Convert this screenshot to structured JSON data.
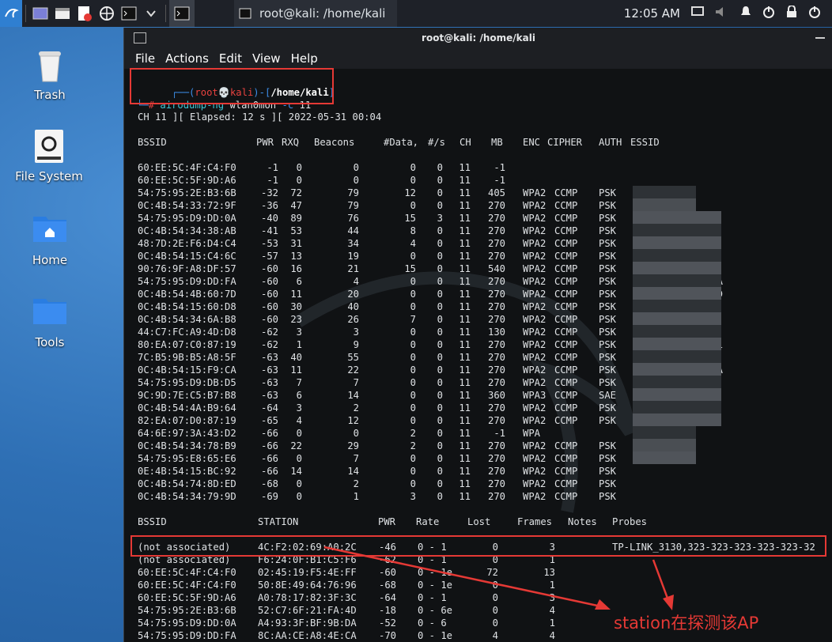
{
  "taskbar": {
    "task_title": "root@kali: /home/kali",
    "clock": "12:05 AM",
    "launchers": [
      "kali-menu-icon",
      "workspace-icon",
      "file-manager-icon",
      "text-editor-icon",
      "browser-icon",
      "terminal-icon",
      "dropdown-icon"
    ]
  },
  "desktop": {
    "icons": [
      {
        "label": "Trash",
        "icon": "trash-icon"
      },
      {
        "label": "File System",
        "icon": "drive-icon"
      },
      {
        "label": "Home",
        "icon": "home-folder-icon"
      },
      {
        "label": "Tools",
        "icon": "folder-icon"
      }
    ]
  },
  "terminal": {
    "title": "root@kali: /home/kali",
    "menu": [
      "File",
      "Actions",
      "Edit",
      "View",
      "Help"
    ],
    "prompt": {
      "user": "root",
      "host": "kali",
      "path": "/home/kali",
      "hash": "#",
      "cmd": "airodump-ng",
      "args": "wlan0mon",
      "flag": "-c",
      "flag_val": "11"
    },
    "status_line": "CH 11 ][ Elapsed: 12 s ][ 2022-05-31 00:04",
    "ap_headers": [
      "BSSID",
      "PWR",
      "RXQ",
      "Beacons",
      "#Data,",
      "#/s",
      "CH",
      "MB",
      "ENC",
      "CIPHER",
      "AUTH",
      "ESSID"
    ],
    "aps": [
      [
        "60:EE:5C:4F:C4:F0",
        "-1",
        "0",
        "0",
        "0",
        "0",
        "11",
        "-1",
        "",
        "",
        "",
        ""
      ],
      [
        "60:EE:5C:5F:9D:A6",
        "-1",
        "0",
        "0",
        "0",
        "0",
        "11",
        "-1",
        "",
        "",
        "",
        ""
      ],
      [
        "54:75:95:2E:B3:6B",
        "-32",
        "72",
        "79",
        "12",
        "0",
        "11",
        "405",
        "WPA2",
        "CCMP",
        "PSK",
        ""
      ],
      [
        "0C:4B:54:33:72:9F",
        "-36",
        "47",
        "79",
        "0",
        "0",
        "11",
        "270",
        "WPA2",
        "CCMP",
        "PSK",
        ""
      ],
      [
        "54:75:95:D9:DD:0A",
        "-40",
        "89",
        "76",
        "15",
        "3",
        "11",
        "270",
        "WPA2",
        "CCMP",
        "PSK",
        ""
      ],
      [
        "0C:4B:54:34:38:AB",
        "-41",
        "53",
        "44",
        "8",
        "0",
        "11",
        "270",
        "WPA2",
        "CCMP",
        "PSK",
        ""
      ],
      [
        "48:7D:2E:F6:D4:C4",
        "-53",
        "31",
        "34",
        "4",
        "0",
        "11",
        "270",
        "WPA2",
        "CCMP",
        "PSK",
        ""
      ],
      [
        "0C:4B:54:15:C4:6C",
        "-57",
        "13",
        "19",
        "0",
        "0",
        "11",
        "270",
        "WPA2",
        "CCMP",
        "PSK",
        ""
      ],
      [
        "90:76:9F:A8:DF:57",
        "-60",
        "16",
        "21",
        "15",
        "0",
        "11",
        "540",
        "WPA2",
        "CCMP",
        "PSK",
        ""
      ],
      [
        "54:75:95:D9:DD:FA",
        "-60",
        "6",
        "4",
        "0",
        "0",
        "11",
        "270",
        "WPA2",
        "CCMP",
        "PSK",
        "A"
      ],
      [
        "0C:4B:54:4B:60:7D",
        "-60",
        "11",
        "20",
        "0",
        "0",
        "11",
        "270",
        "WPA2",
        "CCMP",
        "PSK",
        "D"
      ],
      [
        "0C:4B:54:15:60:D8",
        "-60",
        "30",
        "40",
        "0",
        "0",
        "11",
        "270",
        "WPA2",
        "CCMP",
        "PSK",
        ""
      ],
      [
        "0C:4B:54:34:6A:B8",
        "-60",
        "23",
        "26",
        "7",
        "0",
        "11",
        "270",
        "WPA2",
        "CCMP",
        "PSK",
        ""
      ],
      [
        "44:C7:FC:A9:4D:D8",
        "-62",
        "3",
        "3",
        "0",
        "0",
        "11",
        "130",
        "WPA2",
        "CCMP",
        "PSK",
        ""
      ],
      [
        "80:EA:07:C0:87:19",
        "-62",
        "1",
        "9",
        "0",
        "0",
        "11",
        "270",
        "WPA2",
        "CCMP",
        "PSK",
        "Fi"
      ],
      [
        "7C:B5:9B:B5:A8:5F",
        "-63",
        "40",
        "55",
        "0",
        "0",
        "11",
        "270",
        "WPA2",
        "CCMP",
        "PSK",
        ""
      ],
      [
        "0C:4B:54:15:F9:CA",
        "-63",
        "11",
        "22",
        "0",
        "0",
        "11",
        "270",
        "WPA2",
        "CCMP",
        "PSK",
        "A"
      ],
      [
        "54:75:95:D9:DB:D5",
        "-63",
        "7",
        "7",
        "0",
        "0",
        "11",
        "270",
        "WPA2",
        "CCMP",
        "PSK",
        ""
      ],
      [
        "9C:9D:7E:C5:B7:B8",
        "-63",
        "6",
        "14",
        "0",
        "0",
        "11",
        "360",
        "WPA3",
        "CCMP",
        "SAE",
        ""
      ],
      [
        "0C:4B:54:4A:B9:64",
        "-64",
        "3",
        "2",
        "0",
        "0",
        "11",
        "270",
        "WPA2",
        "CCMP",
        "PSK",
        ""
      ],
      [
        "82:EA:07:D0:87:19",
        "-65",
        "4",
        "12",
        "0",
        "0",
        "11",
        "270",
        "WPA2",
        "CCMP",
        "PSK",
        ""
      ],
      [
        "64:6E:97:3A:43:D2",
        "-66",
        "0",
        "0",
        "2",
        "0",
        "11",
        "-1",
        "WPA",
        "",
        "",
        ""
      ],
      [
        "0C:4B:54:34:78:B9",
        "-66",
        "22",
        "29",
        "2",
        "0",
        "11",
        "270",
        "WPA2",
        "CCMP",
        "PSK",
        ""
      ],
      [
        "54:75:95:E8:65:E6",
        "-66",
        "0",
        "7",
        "0",
        "0",
        "11",
        "270",
        "WPA2",
        "CCMP",
        "PSK",
        ""
      ],
      [
        "0E:4B:54:15:BC:92",
        "-66",
        "14",
        "14",
        "0",
        "0",
        "11",
        "270",
        "WPA2",
        "CCMP",
        "PSK",
        ""
      ],
      [
        "0C:4B:54:74:8D:ED",
        "-68",
        "0",
        "2",
        "0",
        "0",
        "11",
        "270",
        "WPA2",
        "CCMP",
        "PSK",
        ""
      ],
      [
        "0C:4B:54:34:79:9D",
        "-69",
        "0",
        "1",
        "3",
        "0",
        "11",
        "270",
        "WPA2",
        "CCMP",
        "PSK",
        ""
      ]
    ],
    "sta_headers": [
      "BSSID",
      "STATION",
      "PWR",
      "Rate",
      "Lost",
      "Frames",
      "Notes",
      "Probes"
    ],
    "stations": [
      [
        "(not associated)",
        "4C:F2:02:69:A0:2C",
        "-46",
        "0 - 1",
        "0",
        "3",
        "",
        "TP-LINK_3130,323-323-323-323-323-32"
      ],
      [
        "(not associated)",
        "F6:24:0F:B1:C5:F6",
        "-62",
        "0 - 1",
        "0",
        "1",
        "",
        ""
      ],
      [
        "60:EE:5C:4F:C4:F0",
        "02:45:19:F5:4E:FF",
        "-60",
        "0 - 1e",
        "72",
        "13",
        "",
        ""
      ],
      [
        "60:EE:5C:4F:C4:F0",
        "50:8E:49:64:76:96",
        "-68",
        "0 - 1e",
        "0",
        "1",
        "",
        ""
      ],
      [
        "60:EE:5C:5F:9D:A6",
        "A0:78:17:82:3F:3C",
        "-64",
        "0 - 1",
        "0",
        "3",
        "",
        ""
      ],
      [
        "54:75:95:2E:B3:6B",
        "52:C7:6F:21:FA:4D",
        "-18",
        "0 - 6e",
        "0",
        "4",
        "",
        ""
      ],
      [
        "54:75:95:D9:DD:0A",
        "A4:93:3F:BF:9B:DA",
        "-52",
        "0 - 6",
        "0",
        "1",
        "",
        ""
      ],
      [
        "54:75:95:D9:DD:FA",
        "8C:AA:CE:A8:4E:CA",
        "-70",
        "0 - 1e",
        "4",
        "4",
        "",
        ""
      ]
    ]
  },
  "annotation": {
    "text": "station在探测该AP",
    "color": "#e53935"
  }
}
